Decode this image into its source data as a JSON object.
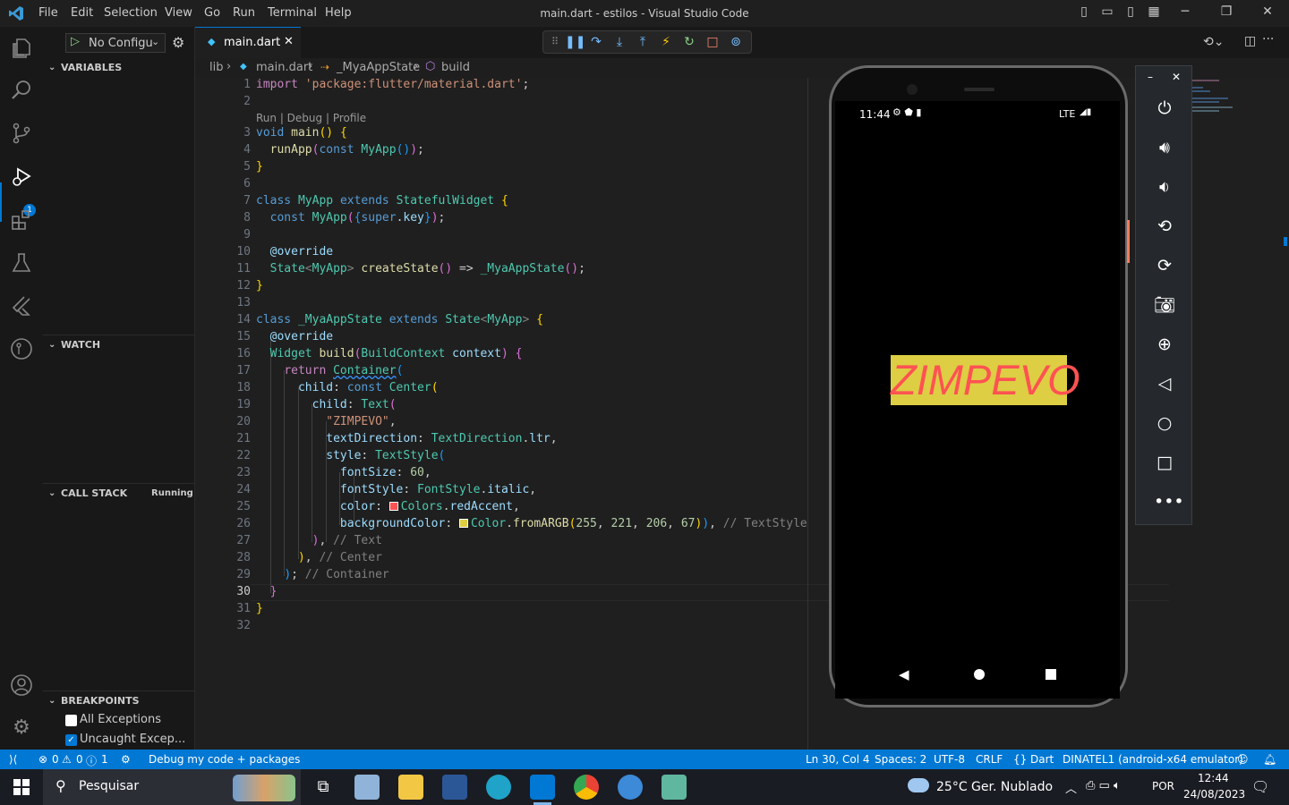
{
  "window": {
    "title": "main.dart - estilos - Visual Studio Code",
    "menu": [
      "File",
      "Edit",
      "Selection",
      "View",
      "Go",
      "Run",
      "Terminal",
      "Help"
    ]
  },
  "activity_bar": {
    "debug_badge": "1"
  },
  "sidebar": {
    "run_config": "No Configu",
    "sections": {
      "variables": "VARIABLES",
      "watch": "WATCH",
      "call_stack": "CALL STACK",
      "call_stack_status": "Running",
      "breakpoints": "BREAKPOINTS"
    },
    "breakpoints": [
      {
        "label": "All Exceptions",
        "checked": false
      },
      {
        "label": "Uncaught Excep...",
        "checked": true
      }
    ]
  },
  "tabs": [
    {
      "label": "main.dart",
      "active": true
    }
  ],
  "breadcrumb": {
    "folder": "lib",
    "file": "main.dart",
    "class": "_MyaAppState",
    "method": "build"
  },
  "editor": {
    "codelens": "Run | Debug | Profile",
    "current_line": 30,
    "line_numbers": [
      "1",
      "2",
      "3",
      "4",
      "5",
      "6",
      "7",
      "8",
      "9",
      "10",
      "11",
      "12",
      "13",
      "14",
      "15",
      "16",
      "17",
      "18",
      "19",
      "20",
      "21",
      "22",
      "23",
      "24",
      "25",
      "26",
      "27",
      "28",
      "29",
      "30",
      "31",
      "32"
    ]
  },
  "emulator": {
    "status_time": "11:44",
    "status_network": "LTE",
    "app_text": "ZIMPEVO",
    "app_text_color": "#ff5252",
    "app_background_color": "#ddce43"
  },
  "statusbar": {
    "errors": "0",
    "warnings": "0",
    "info": "1",
    "debug_target": "Debug my code + packages",
    "position": "Ln 30, Col 4",
    "spaces": "Spaces: 2",
    "encoding": "UTF-8",
    "eol": "CRLF",
    "language": "Dart",
    "device": "DINATEL1 (android-x64 emulator)"
  },
  "taskbar": {
    "search": "Pesquisar",
    "weather": "25°C  Ger. Nublado",
    "language": "POR",
    "time": "12:44",
    "date": "24/08/2023"
  },
  "colors": {
    "accent": "#0078d4",
    "editor_bg": "#1f1f1f",
    "sidebar_bg": "#181818"
  }
}
